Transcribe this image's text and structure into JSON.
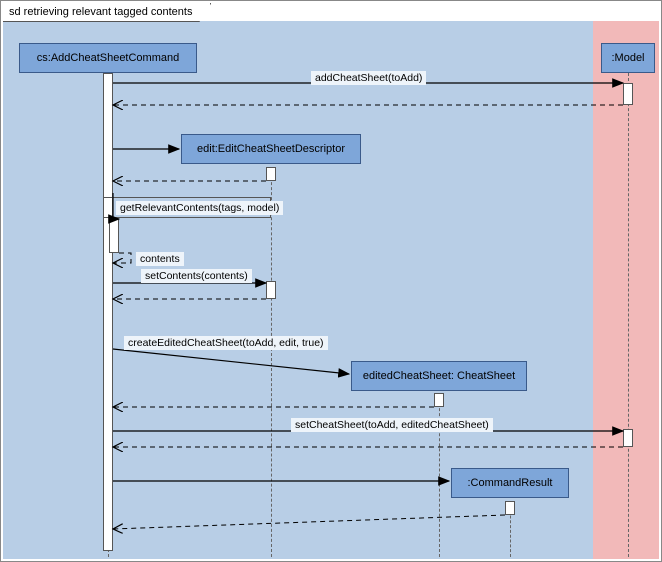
{
  "frame": {
    "title": "sd retrieving relevant tagged contents"
  },
  "participants": {
    "cs": "cs:AddCheatSheetCommand",
    "model": ":Model",
    "edit": "edit:EditCheatSheetDescriptor",
    "edited": "editedCheatSheet: CheatSheet",
    "result": ":CommandResult"
  },
  "messages": {
    "m1": "addCheatSheet(toAdd)",
    "m2": "getRelevantContents(tags, model)",
    "m3": "contents",
    "m4": "setContents(contents)",
    "m5": "createEditedCheatSheet(toAdd, edit, true)",
    "m6": "setCheatSheet(toAdd, editedCheatSheet)"
  },
  "chart_data": {
    "type": "sequence_diagram",
    "title": "sd retrieving relevant tagged contents",
    "lifelines": [
      {
        "id": "cs",
        "name": "cs:AddCheatSheetCommand"
      },
      {
        "id": "model",
        "name": ":Model"
      },
      {
        "id": "edit",
        "name": "edit:EditCheatSheetDescriptor",
        "created_by": "cs"
      },
      {
        "id": "editedCheatSheet",
        "name": "editedCheatSheet: CheatSheet",
        "created_by": "cs"
      },
      {
        "id": "commandResult",
        "name": ":CommandResult",
        "created_by": "cs"
      }
    ],
    "messages": [
      {
        "from": "cs",
        "to": "model",
        "label": "addCheatSheet(toAdd)",
        "type": "sync"
      },
      {
        "from": "model",
        "to": "cs",
        "type": "return"
      },
      {
        "from": "cs",
        "to": "edit",
        "type": "create"
      },
      {
        "from": "edit",
        "to": "cs",
        "type": "return"
      },
      {
        "from": "cs",
        "to": "cs",
        "label": "getRelevantContents(tags, model)",
        "type": "self"
      },
      {
        "from": "cs",
        "to": "cs",
        "label": "contents",
        "type": "self_return"
      },
      {
        "from": "cs",
        "to": "edit",
        "label": "setContents(contents)",
        "type": "sync"
      },
      {
        "from": "edit",
        "to": "cs",
        "type": "return"
      },
      {
        "from": "cs",
        "to": "editedCheatSheet",
        "label": "createEditedCheatSheet(toAdd, edit, true)",
        "type": "create"
      },
      {
        "from": "editedCheatSheet",
        "to": "cs",
        "type": "return"
      },
      {
        "from": "cs",
        "to": "model",
        "label": "setCheatSheet(toAdd, editedCheatSheet)",
        "type": "sync"
      },
      {
        "from": "model",
        "to": "cs",
        "type": "return"
      },
      {
        "from": "cs",
        "to": "commandResult",
        "type": "create"
      },
      {
        "from": "commandResult",
        "to": "cs",
        "type": "return"
      }
    ]
  }
}
